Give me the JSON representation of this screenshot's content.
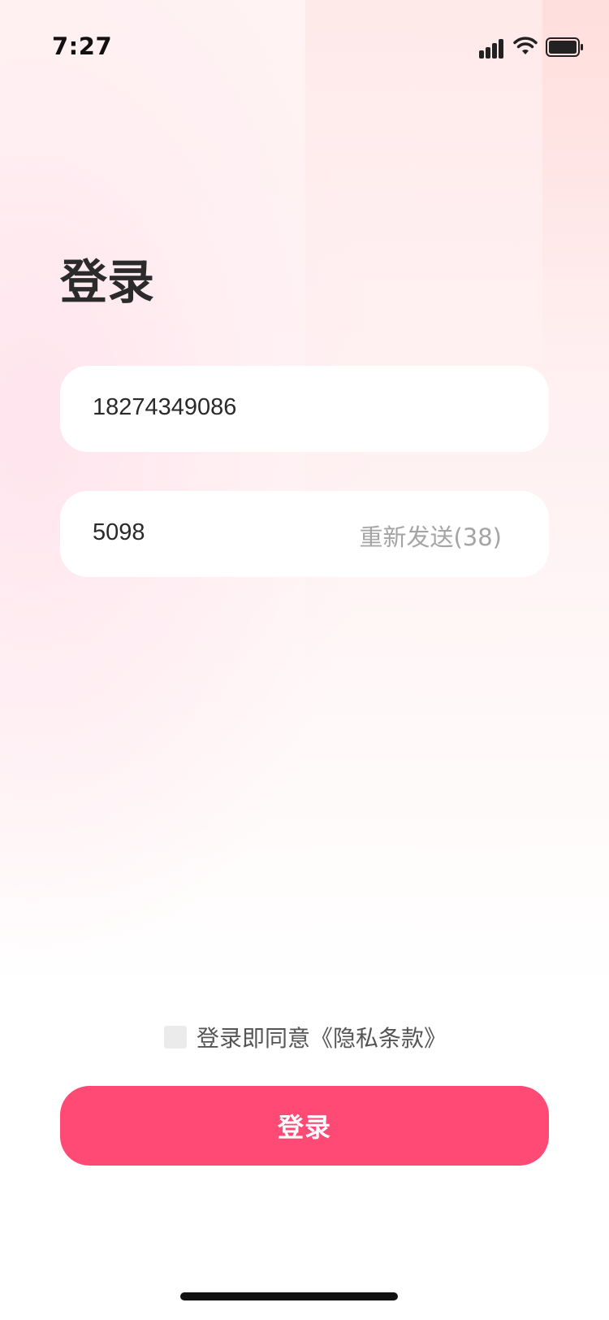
{
  "status_bar": {
    "time": "7:27"
  },
  "page": {
    "title": "登录"
  },
  "form": {
    "phone_value": "18274349086",
    "code_value": "5098",
    "resend_label": "重新发送(38)"
  },
  "agreement": {
    "label": "登录即同意《隐私条款》",
    "checked": false
  },
  "login_button": {
    "label": "登录"
  },
  "colors": {
    "accent": "#ff4a76",
    "title": "#2b2b2b",
    "muted": "#a4a4a4"
  }
}
